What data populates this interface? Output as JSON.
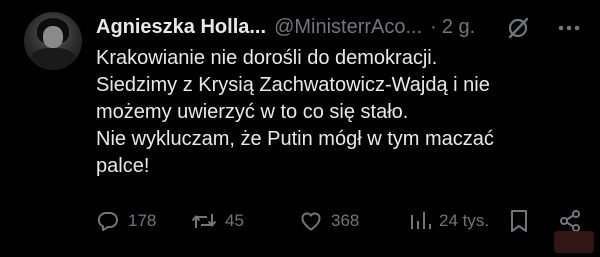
{
  "author": {
    "display_name": "Agnieszka Holla...",
    "handle": "@MinisterrAco...",
    "separator": "·",
    "time": "2 g."
  },
  "icons": {
    "grok": "grok-slash-circle-icon",
    "more": "more-options-icon",
    "reply": "reply-bubble-icon",
    "repost": "repost-arrows-icon",
    "like": "heart-icon",
    "views": "views-bar-chart-icon",
    "bookmark": "bookmark-icon",
    "share": "share-icon"
  },
  "text": {
    "lines": [
      "Krakowianie nie dorośli do demokracji.",
      "Siedzimy z Krysią Zachwatowicz-Wajdą i nie",
      "możemy uwierzyć w to co się stało.",
      "Nie wykluczam, że Putin mógł w tym maczać",
      "palce!"
    ]
  },
  "actions": {
    "replies": "178",
    "reposts": "45",
    "likes": "368",
    "views": "24 tys."
  },
  "colors": {
    "background": "#000000",
    "text": "#e7e9ea",
    "muted": "#71767b"
  }
}
